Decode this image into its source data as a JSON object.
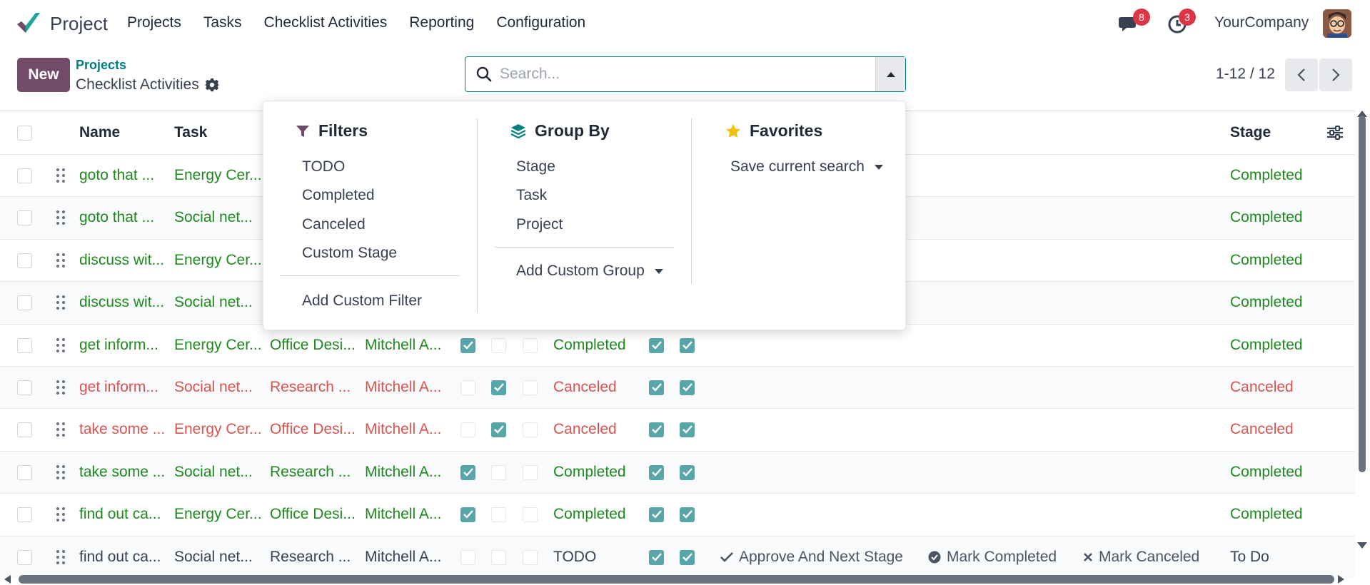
{
  "app": {
    "name": "Project",
    "company": "YourCompany"
  },
  "menu": [
    "Projects",
    "Tasks",
    "Checklist Activities",
    "Reporting",
    "Configuration"
  ],
  "systray": {
    "messages_count": "8",
    "activities_count": "3"
  },
  "control": {
    "new_label": "New",
    "breadcrumb_parent": "Projects",
    "breadcrumb_current": "Checklist Activities",
    "search_placeholder": "Search...",
    "pager": "1-12 / 12"
  },
  "columns": {
    "name": "Name",
    "task": "Task",
    "stage": "Stage"
  },
  "rows": [
    {
      "name": "goto that ...",
      "task": "Energy Cer...",
      "project": "",
      "user": "",
      "c1": null,
      "c2": null,
      "c3": null,
      "state": "",
      "c4": null,
      "c5": null,
      "stage": "Completed",
      "tone": "green"
    },
    {
      "name": "goto that ...",
      "task": "Social net...",
      "project": "",
      "user": "",
      "c1": null,
      "c2": null,
      "c3": null,
      "state": "",
      "c4": null,
      "c5": null,
      "stage": "Completed",
      "tone": "green"
    },
    {
      "name": "discuss wit...",
      "task": "Energy Cer...",
      "project": "",
      "user": "",
      "c1": null,
      "c2": null,
      "c3": null,
      "state": "",
      "c4": null,
      "c5": null,
      "stage": "Completed",
      "tone": "green"
    },
    {
      "name": "discuss wit...",
      "task": "Social net...",
      "project": "",
      "user": "",
      "c1": null,
      "c2": null,
      "c3": null,
      "state": "",
      "c4": null,
      "c5": null,
      "stage": "Completed",
      "tone": "green"
    },
    {
      "name": "get inform...",
      "task": "Energy Cer...",
      "project": "Office Desi...",
      "user": "Mitchell A...",
      "c1": true,
      "c2": false,
      "c3": false,
      "state": "Completed",
      "c4": true,
      "c5": true,
      "stage": "Completed",
      "tone": "green"
    },
    {
      "name": "get inform...",
      "task": "Social net...",
      "project": "Research ...",
      "user": "Mitchell A...",
      "c1": false,
      "c2": true,
      "c3": false,
      "state": "Canceled",
      "c4": true,
      "c5": true,
      "stage": "Canceled",
      "tone": "red"
    },
    {
      "name": "take some ...",
      "task": "Energy Cer...",
      "project": "Office Desi...",
      "user": "Mitchell A...",
      "c1": false,
      "c2": true,
      "c3": false,
      "state": "Canceled",
      "c4": true,
      "c5": true,
      "stage": "Canceled",
      "tone": "red"
    },
    {
      "name": "take some ...",
      "task": "Social net...",
      "project": "Research ...",
      "user": "Mitchell A...",
      "c1": true,
      "c2": false,
      "c3": false,
      "state": "Completed",
      "c4": true,
      "c5": true,
      "stage": "Completed",
      "tone": "green"
    },
    {
      "name": "find out ca...",
      "task": "Energy Cer...",
      "project": "Office Desi...",
      "user": "Mitchell A...",
      "c1": true,
      "c2": false,
      "c3": false,
      "state": "Completed",
      "c4": true,
      "c5": true,
      "stage": "Completed",
      "tone": "green"
    },
    {
      "name": "find out ca...",
      "task": "Social net...",
      "project": "Research ...",
      "user": "Mitchell A...",
      "c1": false,
      "c2": false,
      "c3": false,
      "state": "TODO",
      "c4": true,
      "c5": true,
      "stage": "To Do",
      "tone": "dark"
    }
  ],
  "row_actions": {
    "approve": "Approve And Next Stage",
    "complete": "Mark Completed",
    "cancel": "Mark Canceled"
  },
  "dropdown": {
    "filters": {
      "title": "Filters",
      "items": [
        "TODO",
        "Completed",
        "Canceled",
        "Custom Stage"
      ],
      "add": "Add Custom Filter"
    },
    "group_by": {
      "title": "Group By",
      "items": [
        "Stage",
        "Task",
        "Project"
      ],
      "add": "Add Custom Group"
    },
    "favorites": {
      "title": "Favorites",
      "save": "Save current search"
    }
  },
  "colors": {
    "brand": "#714b67",
    "accent": "#017e84",
    "success": "#1e8a1e",
    "danger": "#d9534f",
    "checkbox_on": "#58a6aa"
  }
}
